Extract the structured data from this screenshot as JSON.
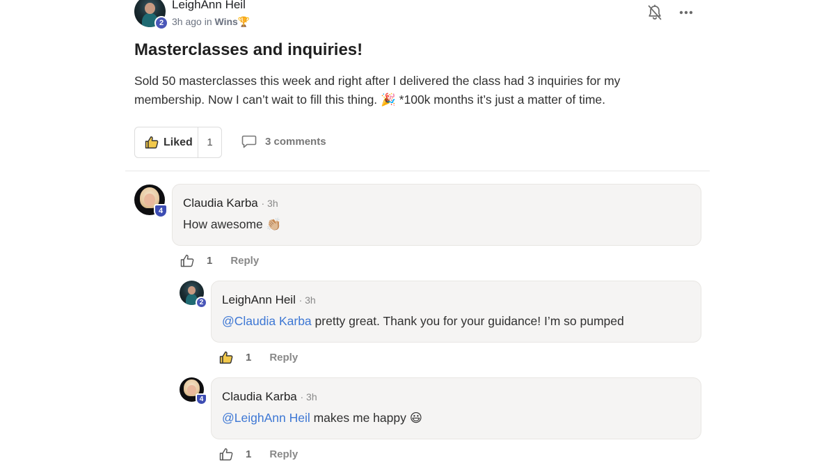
{
  "post": {
    "author": "LeighAnn Heil",
    "author_level": "2",
    "time": "3h ago",
    "in_label": "in",
    "category": "Wins",
    "category_icon": "🏆",
    "title": "Masterclasses and inquiries!",
    "body": "Sold 50 masterclasses this week and right after I delivered the class had 3 inquiries for my membership. Now I can’t wait to fill this thing. 🎉 *100k months it’s just a matter of time.",
    "like_label": "Liked",
    "like_count": "1",
    "comments_label": "3 comments"
  },
  "comments": [
    {
      "author": "Claudia Karba",
      "level": "4",
      "time": "· 3h",
      "mention": "",
      "text": "How awesome 👏🏼",
      "like_count": "1",
      "reply_label": "Reply"
    },
    {
      "author": "LeighAnn Heil",
      "level": "2",
      "time": "· 3h",
      "mention": "@Claudia Karba",
      "text": " pretty great. Thank you for your guidance! I’m so pumped",
      "like_count": "1",
      "reply_label": "Reply"
    },
    {
      "author": "Claudia Karba",
      "level": "4",
      "time": "· 3h",
      "mention": "@LeighAnn Heil",
      "text": " makes me happy 😃",
      "like_count": "1",
      "reply_label": "Reply"
    }
  ],
  "colors": {
    "mention": "#3d77d4",
    "level_badge": "#4a57b8",
    "bubble_bg": "#f5f4f3",
    "liked_thumb": "#f2c94c"
  },
  "icons": {
    "bell": "bell-off-icon",
    "more": "more-horizontal-icon",
    "like": "thumbs-up-icon",
    "comment": "comment-icon"
  }
}
